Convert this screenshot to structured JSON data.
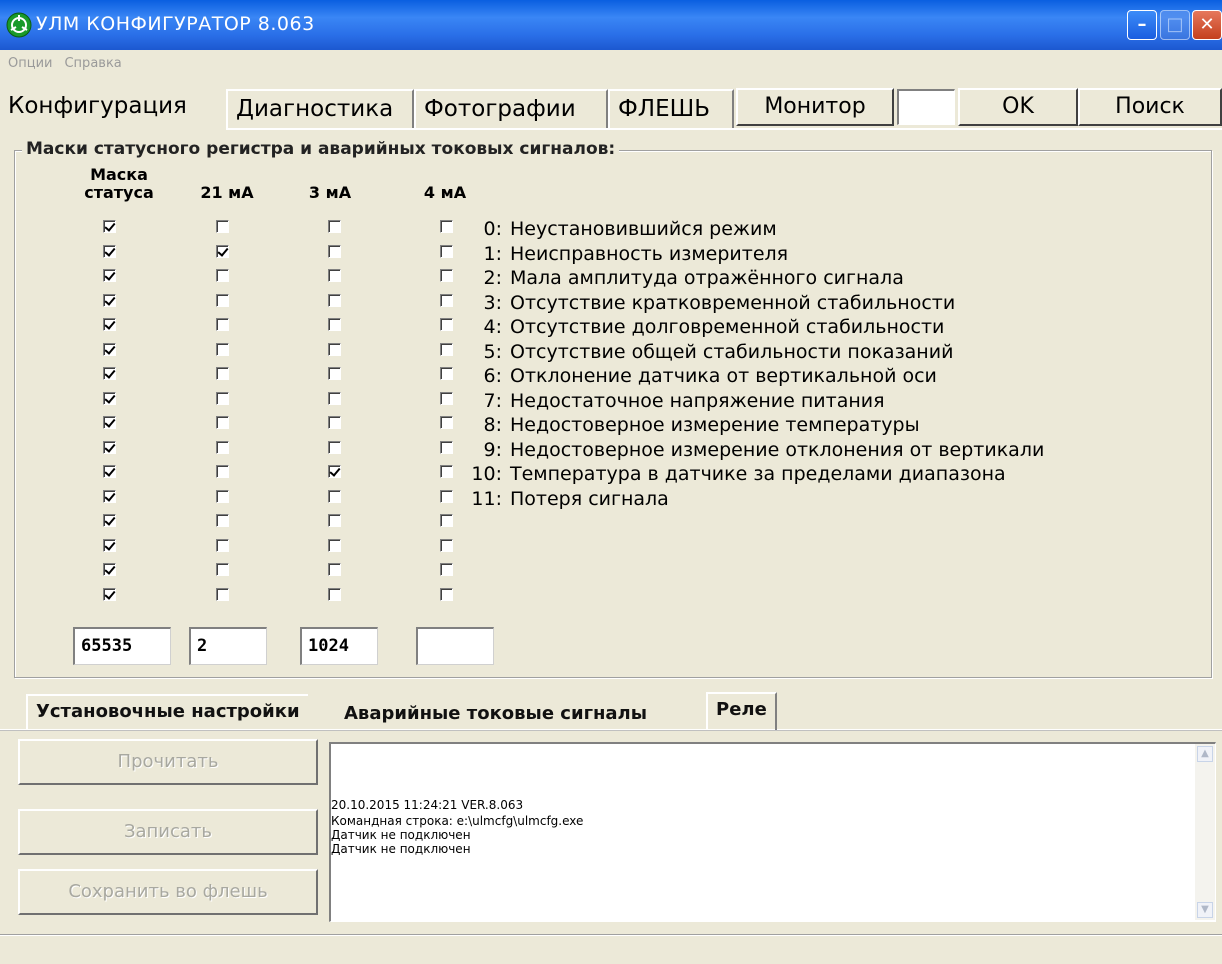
{
  "window": {
    "title": "УЛМ КОНФИГУРАТОР 8.063"
  },
  "menu": {
    "items": [
      "Опции",
      "Справка"
    ]
  },
  "top_tabs": [
    "Конфигурация",
    "Диагностика",
    "Фотографии",
    "ФЛЕШЬ"
  ],
  "top_buttons": {
    "monitor": "Монитор",
    "ok": "OK",
    "search": "Поиск",
    "input_value": ""
  },
  "group": {
    "title": "Маски статусного регистра и аварийных токовых сигналов:",
    "col_mask_line1": "Маска",
    "col_mask_line2": "статуса",
    "col_21": "21 мА",
    "col_3": "3 мА",
    "col_4": "4 мА"
  },
  "signals": [
    {
      "num": "0:",
      "label": "Неустановившийся режим"
    },
    {
      "num": "1:",
      "label": "Неисправность измерителя"
    },
    {
      "num": "2:",
      "label": "Мала амплитуда отражённого сигнала"
    },
    {
      "num": "3:",
      "label": "Отсутствие кратковременной стабильности"
    },
    {
      "num": "4:",
      "label": "Отсутствие долговременной стабильности"
    },
    {
      "num": "5:",
      "label": "Отсутствие общей стабильности показаний"
    },
    {
      "num": "6:",
      "label": "Отклонение датчика от вертикальной оси"
    },
    {
      "num": "7:",
      "label": "Недостаточное напряжение питания"
    },
    {
      "num": "8:",
      "label": "Недостоверное измерение температуры"
    },
    {
      "num": "9:",
      "label": "Недостоверное измерение отклонения от вертикали"
    },
    {
      "num": "10:",
      "label": "Температура в датчике за пределами диапазона"
    },
    {
      "num": "11:",
      "label": "Потеря сигнала"
    }
  ],
  "checkboxes": {
    "mask": [
      true,
      true,
      true,
      true,
      true,
      true,
      true,
      true,
      true,
      true,
      true,
      true,
      true,
      true,
      true,
      true
    ],
    "ma21": [
      false,
      true,
      false,
      false,
      false,
      false,
      false,
      false,
      false,
      false,
      false,
      false,
      false,
      false,
      false,
      false
    ],
    "ma3": [
      false,
      false,
      false,
      false,
      false,
      false,
      false,
      false,
      false,
      false,
      true,
      false,
      false,
      false,
      false,
      false
    ],
    "ma4": [
      false,
      false,
      false,
      false,
      false,
      false,
      false,
      false,
      false,
      false,
      false,
      false,
      false,
      false,
      false,
      false
    ]
  },
  "mask_values": {
    "mask": "65535",
    "ma21": "2",
    "ma3": "1024",
    "ma4": ""
  },
  "bottom_tabs": [
    "Установочные настройки",
    "Аварийные токовые сигналы",
    "Реле"
  ],
  "actions": {
    "read": "Прочитать",
    "write": "Записать",
    "save_flash": "Сохранить во флешь"
  },
  "log": [
    "20.10.2015 11:24:21 VER.8.063",
    "Командная строка:  e:\\ulmcfg\\ulmcfg.exe",
    "Датчик не подключен",
    "Датчик не подключен"
  ],
  "icons": {
    "app": "app-logo-icon",
    "minimize": "minimize-icon",
    "maximize": "maximize-icon",
    "close": "close-icon"
  }
}
